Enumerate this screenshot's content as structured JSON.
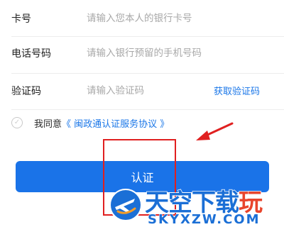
{
  "form": {
    "card": {
      "label": "卡号",
      "placeholder": "请输入您本人的银行卡号"
    },
    "phone": {
      "label": "电话号码",
      "placeholder": "请输入银行预留的手机号码"
    },
    "code": {
      "label": "验证码",
      "placeholder": "请输入验证码",
      "get_code_label": "获取验证码"
    }
  },
  "agreement": {
    "prefix": "我同意",
    "link": "《 闽政通认证服务协议 》",
    "checked": false
  },
  "submit_label": "认证",
  "watermark": {
    "title": "天空下载",
    "title_accent": "玩",
    "subtitle": "SKYXZW.COM"
  },
  "colors": {
    "accent": "#1976e8",
    "button": "#1a73e8",
    "annotation": "#e02020",
    "watermark": "#1b6fd6",
    "watermark_accent": "#e8452c"
  }
}
